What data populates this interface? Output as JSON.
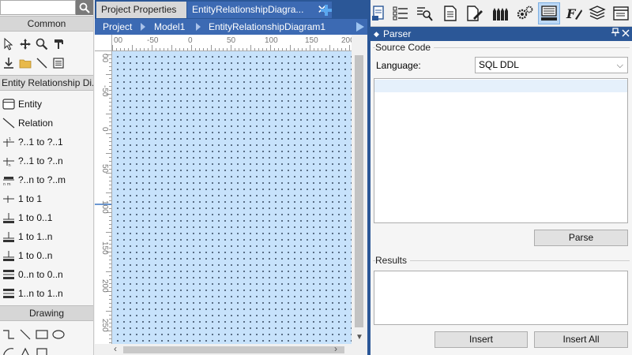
{
  "toolbox": {
    "search_placeholder": "",
    "common_label": "Common",
    "diagram_label": "Entity Relationship Di...",
    "items": [
      {
        "label": "Entity",
        "icon": "entity-icon"
      },
      {
        "label": "Relation",
        "icon": "relation-line-icon"
      },
      {
        "label": "?..1 to ?..1",
        "icon": "relation-optional-one-to-one-icon"
      },
      {
        "label": "?..1 to ?..n",
        "icon": "relation-optional-one-to-many-icon"
      },
      {
        "label": "?..n to ?..m",
        "icon": "relation-optional-many-to-many-icon"
      },
      {
        "label": "1 to 1",
        "icon": "relation-one-to-one-icon"
      },
      {
        "label": "1 to 0..1",
        "icon": "relation-one-to-zero-one-icon"
      },
      {
        "label": "1 to 1..n",
        "icon": "relation-one-to-one-many-icon"
      },
      {
        "label": "1 to 0..n",
        "icon": "relation-one-to-zero-many-icon"
      },
      {
        "label": "0..n to 0..n",
        "icon": "relation-zero-many-to-zero-many-icon"
      },
      {
        "label": "1..n to 1..n",
        "icon": "relation-one-many-to-one-many-icon"
      }
    ],
    "drawing_label": "Drawing"
  },
  "document": {
    "tabs": [
      {
        "label": "Project Properties"
      },
      {
        "label": "EntityRelationshipDiagra..."
      }
    ],
    "breadcrumb": [
      "Project",
      "Model1",
      "EntityRelationshipDiagram1"
    ],
    "ruler_top_labels": [
      "00",
      "-50",
      "0",
      "50",
      "100",
      "150",
      "200"
    ],
    "ruler_left_labels": [
      "00",
      "-50",
      "0",
      "50",
      "100",
      "150",
      "200",
      "250"
    ]
  },
  "parser": {
    "title": "Parser",
    "source_code_label": "Source Code",
    "language_label": "Language:",
    "language_value": "SQL DDL",
    "parse_label": "Parse",
    "results_label": "Results",
    "insert_label": "Insert",
    "insert_all_label": "Insert All"
  },
  "colors": {
    "accent": "#2b5797",
    "tab_active": "#3c6ab3",
    "canvas": "#c7e2fb"
  }
}
